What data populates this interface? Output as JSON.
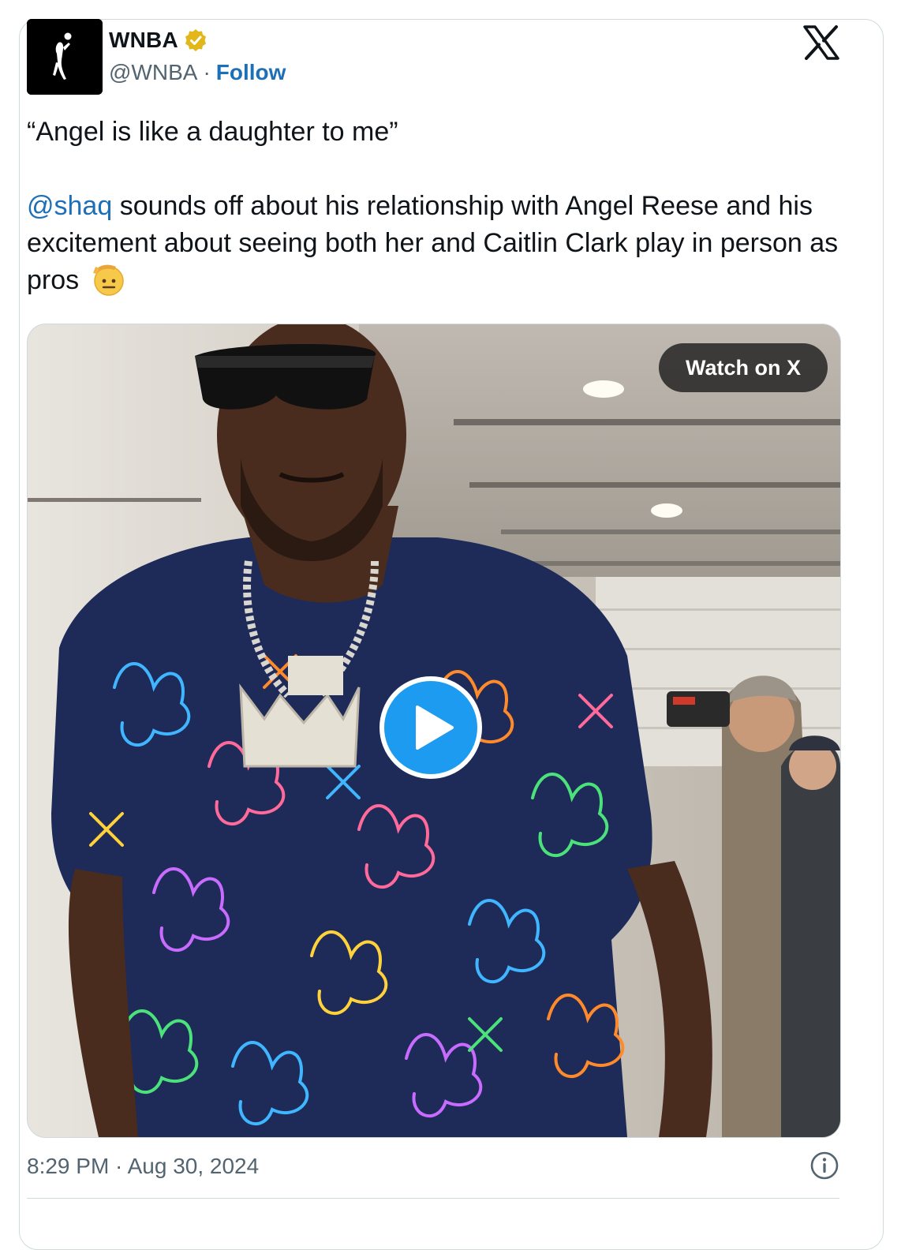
{
  "author": {
    "display_name": "WNBA",
    "handle": "@WNBA",
    "separator": "·",
    "follow_label": "Follow"
  },
  "tweet": {
    "quote": "“Angel is like a daughter to me”",
    "mention": "@shaq",
    "body": " sounds off about his relationship with Angel Reese and his excitement about seeing both her and Caitlin Clark play in person as pros "
  },
  "media": {
    "watch_label": "Watch on X"
  },
  "footer": {
    "timestamp": "8:29 PM · Aug 30, 2024"
  },
  "colors": {
    "link": "#1d6fb8",
    "play_button": "#1d9bf0",
    "verified_badge": "#e2b719"
  },
  "icons": {
    "verified": "verified-badge-icon",
    "x_logo": "x-logo-icon",
    "play": "play-icon",
    "info": "info-icon",
    "emoji": "saluting-face-emoji"
  }
}
